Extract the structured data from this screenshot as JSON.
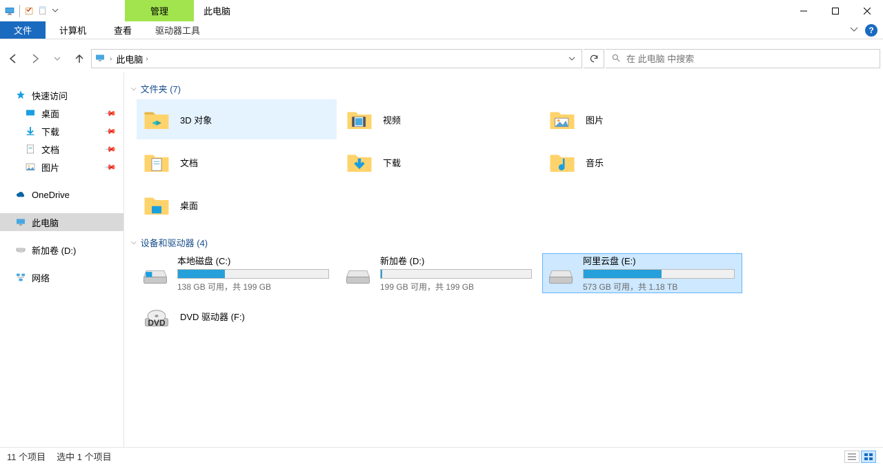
{
  "window": {
    "title": "此电脑",
    "ctx_tab": "管理"
  },
  "ribbon": {
    "file": "文件",
    "computer": "计算机",
    "view": "查看",
    "drive_tools": "驱动器工具"
  },
  "breadcrumb": {
    "location": "此电脑"
  },
  "search": {
    "placeholder": "在 此电脑 中搜索"
  },
  "sidebar": {
    "quick_access": "快速访问",
    "desktop": "桌面",
    "downloads": "下载",
    "documents": "文档",
    "pictures": "图片",
    "onedrive": "OneDrive",
    "this_pc": "此电脑",
    "new_volume_d": "新加卷 (D:)",
    "network": "网络"
  },
  "sections": {
    "folders_header": "文件夹 (7)",
    "drives_header": "设备和驱动器 (4)"
  },
  "folders": {
    "objects3d": "3D 对象",
    "videos": "视频",
    "pictures": "图片",
    "documents": "文档",
    "downloads": "下载",
    "music": "音乐",
    "desktop": "桌面"
  },
  "drives": {
    "c": {
      "name": "本地磁盘 (C:)",
      "sub": "138 GB 可用，共 199 GB",
      "pct": 31
    },
    "d": {
      "name": "新加卷 (D:)",
      "sub": "199 GB 可用，共 199 GB",
      "pct": 1
    },
    "e": {
      "name": "阿里云盘 (E:)",
      "sub": "573 GB 可用，共 1.18 TB",
      "pct": 52
    },
    "dvd": {
      "name": "DVD 驱动器 (F:)"
    }
  },
  "status": {
    "count": "11 个项目",
    "selected": "选中 1 个项目"
  }
}
